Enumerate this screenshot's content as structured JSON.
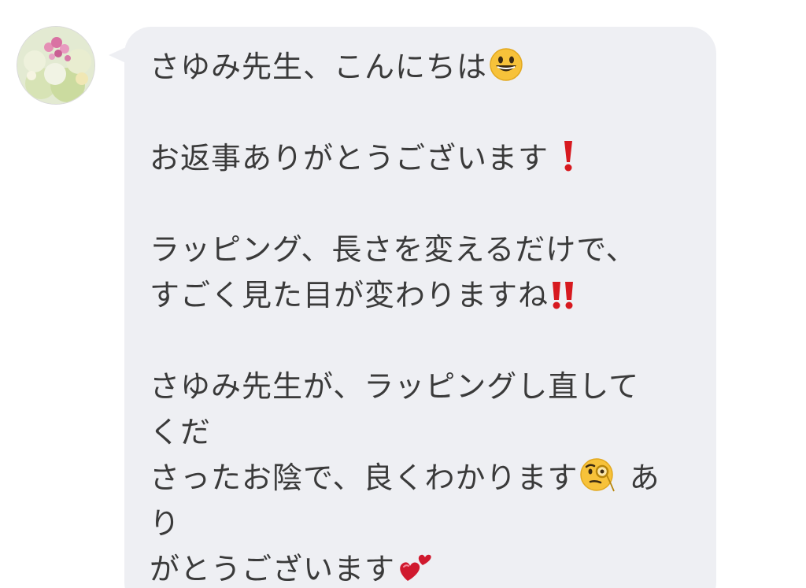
{
  "conversation": {
    "avatar_icon": "flower-bouquet-avatar",
    "bubble_color": "#eeeff3",
    "text_color": "#3a3a3a",
    "lines": [
      {
        "text": "さゆみ先生、こんにちは",
        "emoji": "grinning-face-icon"
      },
      {
        "text": "",
        "gap": true
      },
      {
        "text": "お返事ありがとうございます ",
        "emoji": "exclamation-icon"
      },
      {
        "text": "",
        "gap": true
      },
      {
        "text": "ラッピング、長さを変えるだけで、"
      },
      {
        "text": "すごく見た目が変わりますね",
        "emoji": "double-exclamation-icon"
      },
      {
        "text": "",
        "gap": true
      },
      {
        "text": "さゆみ先生が、ラッピングし直して"
      },
      {
        "text": "くだ"
      },
      {
        "text": "さったお陰で、良くわかります",
        "emoji": "monocle-face-icon",
        "after": " あ"
      },
      {
        "text": "り"
      },
      {
        "text": "がとうございます",
        "emoji": "two-hearts-icon"
      }
    ]
  }
}
